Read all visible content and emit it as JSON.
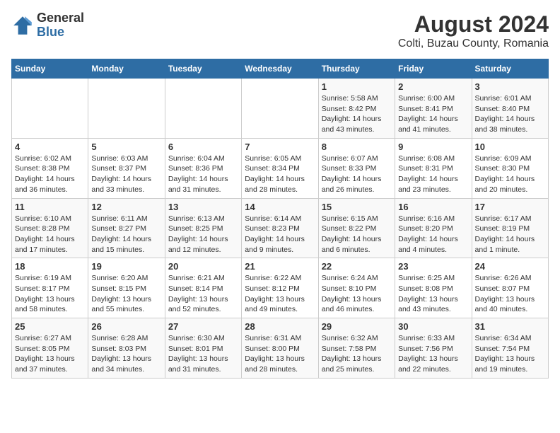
{
  "header": {
    "logo_general": "General",
    "logo_blue": "Blue",
    "title": "August 2024",
    "subtitle": "Colti, Buzau County, Romania"
  },
  "weekdays": [
    "Sunday",
    "Monday",
    "Tuesday",
    "Wednesday",
    "Thursday",
    "Friday",
    "Saturday"
  ],
  "weeks": [
    [
      {
        "day": "",
        "info": ""
      },
      {
        "day": "",
        "info": ""
      },
      {
        "day": "",
        "info": ""
      },
      {
        "day": "",
        "info": ""
      },
      {
        "day": "1",
        "info": "Sunrise: 5:58 AM\nSunset: 8:42 PM\nDaylight: 14 hours and 43 minutes."
      },
      {
        "day": "2",
        "info": "Sunrise: 6:00 AM\nSunset: 8:41 PM\nDaylight: 14 hours and 41 minutes."
      },
      {
        "day": "3",
        "info": "Sunrise: 6:01 AM\nSunset: 8:40 PM\nDaylight: 14 hours and 38 minutes."
      }
    ],
    [
      {
        "day": "4",
        "info": "Sunrise: 6:02 AM\nSunset: 8:38 PM\nDaylight: 14 hours and 36 minutes."
      },
      {
        "day": "5",
        "info": "Sunrise: 6:03 AM\nSunset: 8:37 PM\nDaylight: 14 hours and 33 minutes."
      },
      {
        "day": "6",
        "info": "Sunrise: 6:04 AM\nSunset: 8:36 PM\nDaylight: 14 hours and 31 minutes."
      },
      {
        "day": "7",
        "info": "Sunrise: 6:05 AM\nSunset: 8:34 PM\nDaylight: 14 hours and 28 minutes."
      },
      {
        "day": "8",
        "info": "Sunrise: 6:07 AM\nSunset: 8:33 PM\nDaylight: 14 hours and 26 minutes."
      },
      {
        "day": "9",
        "info": "Sunrise: 6:08 AM\nSunset: 8:31 PM\nDaylight: 14 hours and 23 minutes."
      },
      {
        "day": "10",
        "info": "Sunrise: 6:09 AM\nSunset: 8:30 PM\nDaylight: 14 hours and 20 minutes."
      }
    ],
    [
      {
        "day": "11",
        "info": "Sunrise: 6:10 AM\nSunset: 8:28 PM\nDaylight: 14 hours and 17 minutes."
      },
      {
        "day": "12",
        "info": "Sunrise: 6:11 AM\nSunset: 8:27 PM\nDaylight: 14 hours and 15 minutes."
      },
      {
        "day": "13",
        "info": "Sunrise: 6:13 AM\nSunset: 8:25 PM\nDaylight: 14 hours and 12 minutes."
      },
      {
        "day": "14",
        "info": "Sunrise: 6:14 AM\nSunset: 8:23 PM\nDaylight: 14 hours and 9 minutes."
      },
      {
        "day": "15",
        "info": "Sunrise: 6:15 AM\nSunset: 8:22 PM\nDaylight: 14 hours and 6 minutes."
      },
      {
        "day": "16",
        "info": "Sunrise: 6:16 AM\nSunset: 8:20 PM\nDaylight: 14 hours and 4 minutes."
      },
      {
        "day": "17",
        "info": "Sunrise: 6:17 AM\nSunset: 8:19 PM\nDaylight: 14 hours and 1 minute."
      }
    ],
    [
      {
        "day": "18",
        "info": "Sunrise: 6:19 AM\nSunset: 8:17 PM\nDaylight: 13 hours and 58 minutes."
      },
      {
        "day": "19",
        "info": "Sunrise: 6:20 AM\nSunset: 8:15 PM\nDaylight: 13 hours and 55 minutes."
      },
      {
        "day": "20",
        "info": "Sunrise: 6:21 AM\nSunset: 8:14 PM\nDaylight: 13 hours and 52 minutes."
      },
      {
        "day": "21",
        "info": "Sunrise: 6:22 AM\nSunset: 8:12 PM\nDaylight: 13 hours and 49 minutes."
      },
      {
        "day": "22",
        "info": "Sunrise: 6:24 AM\nSunset: 8:10 PM\nDaylight: 13 hours and 46 minutes."
      },
      {
        "day": "23",
        "info": "Sunrise: 6:25 AM\nSunset: 8:08 PM\nDaylight: 13 hours and 43 minutes."
      },
      {
        "day": "24",
        "info": "Sunrise: 6:26 AM\nSunset: 8:07 PM\nDaylight: 13 hours and 40 minutes."
      }
    ],
    [
      {
        "day": "25",
        "info": "Sunrise: 6:27 AM\nSunset: 8:05 PM\nDaylight: 13 hours and 37 minutes."
      },
      {
        "day": "26",
        "info": "Sunrise: 6:28 AM\nSunset: 8:03 PM\nDaylight: 13 hours and 34 minutes."
      },
      {
        "day": "27",
        "info": "Sunrise: 6:30 AM\nSunset: 8:01 PM\nDaylight: 13 hours and 31 minutes."
      },
      {
        "day": "28",
        "info": "Sunrise: 6:31 AM\nSunset: 8:00 PM\nDaylight: 13 hours and 28 minutes."
      },
      {
        "day": "29",
        "info": "Sunrise: 6:32 AM\nSunset: 7:58 PM\nDaylight: 13 hours and 25 minutes."
      },
      {
        "day": "30",
        "info": "Sunrise: 6:33 AM\nSunset: 7:56 PM\nDaylight: 13 hours and 22 minutes."
      },
      {
        "day": "31",
        "info": "Sunrise: 6:34 AM\nSunset: 7:54 PM\nDaylight: 13 hours and 19 minutes."
      }
    ]
  ]
}
